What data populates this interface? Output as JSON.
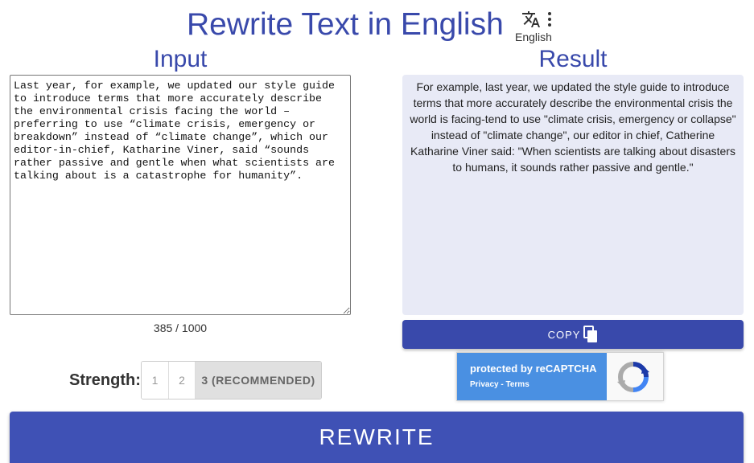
{
  "header": {
    "title": "Rewrite Text in English",
    "language": "English",
    "language_icon": "translate-icon",
    "menu_icon": "more-vert-icon"
  },
  "input": {
    "heading": "Input",
    "text": "Last year, for example, we updated our style guide to introduce terms that more accurately describe the environmental crisis facing the world – preferring to use “climate crisis, emergency or breakdown” instead of “climate change”, which our editor-in-chief, Katharine Viner, said “sounds rather passive and gentle when what scientists are talking about is a catastrophe for humanity”.",
    "char_count": "385 / 1000"
  },
  "result": {
    "heading": "Result",
    "text": "For example, last year, we updated the style guide to introduce terms that more accurately describe the environmental crisis the world is facing-tend to use \"climate crisis, emergency or collapse\" instead of \"climate change\", our editor in chief, Catherine Katharine Viner said: \"When scientists are talking about disasters to humans, it sounds rather passive and gentle.\"",
    "copy_label": "COPY",
    "copy_icon": "copy-icon"
  },
  "recaptcha": {
    "title": "protected by reCAPTCHA",
    "privacy": "Privacy",
    "separator": " - ",
    "terms": "Terms"
  },
  "strength": {
    "label": "Strength:",
    "options": [
      "1",
      "2",
      "3 (RECOMMENDED)"
    ],
    "selected": "3 (RECOMMENDED)"
  },
  "actions": {
    "rewrite_label": "REWRITE"
  },
  "colors": {
    "primary": "#3949ab",
    "rewrite_button": "#3f51b5",
    "result_background": "#e8eaf6",
    "recaptcha_blue": "#4a90e2"
  }
}
